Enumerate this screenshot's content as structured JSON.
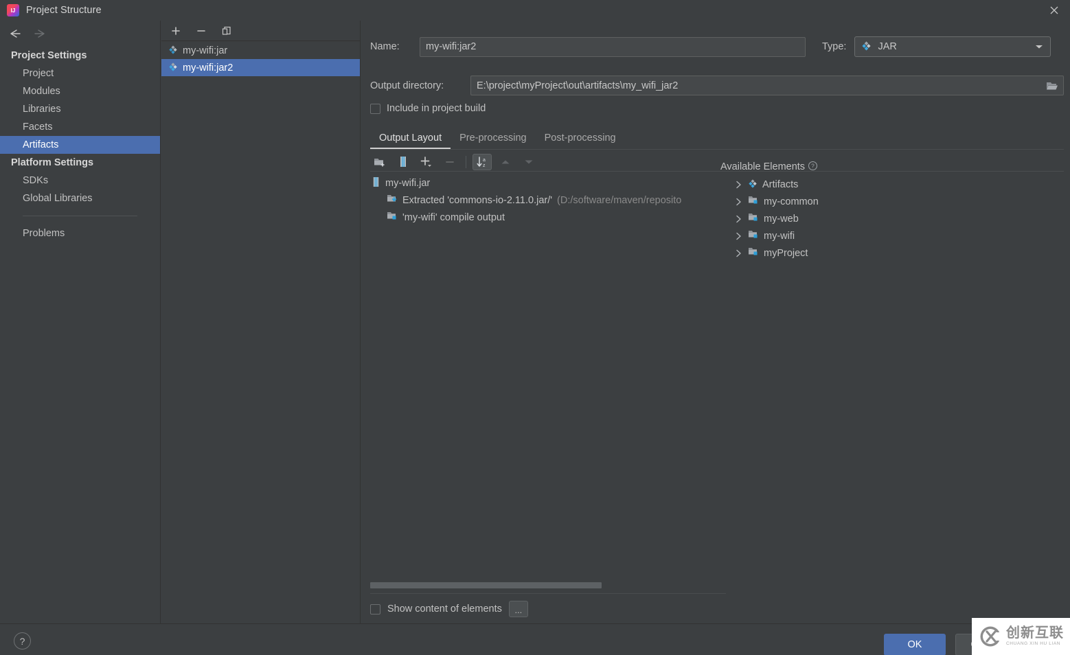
{
  "window": {
    "title": "Project Structure",
    "app_icon": "intellij-idea-icon",
    "close_icon": "close-icon"
  },
  "sidebar": {
    "back_icon": "arrow-left-icon",
    "forward_icon": "arrow-right-icon",
    "groups": [
      {
        "label": "Project Settings",
        "items": [
          {
            "label": "Project",
            "selected": false
          },
          {
            "label": "Modules",
            "selected": false
          },
          {
            "label": "Libraries",
            "selected": false
          },
          {
            "label": "Facets",
            "selected": false
          },
          {
            "label": "Artifacts",
            "selected": true
          }
        ]
      },
      {
        "label": "Platform Settings",
        "items": [
          {
            "label": "SDKs",
            "selected": false
          },
          {
            "label": "Global Libraries",
            "selected": false
          }
        ]
      }
    ],
    "problems": {
      "label": "Problems"
    }
  },
  "artifact_panel": {
    "toolbar": [
      {
        "name": "add-artifact-button",
        "icon": "plus-icon"
      },
      {
        "name": "remove-artifact-button",
        "icon": "minus-icon"
      },
      {
        "name": "copy-artifact-button",
        "icon": "copy-icon"
      }
    ],
    "items": [
      {
        "label": "my-wifi:jar",
        "icon": "artifact-icon",
        "selected": false
      },
      {
        "label": "my-wifi:jar2",
        "icon": "artifact-icon",
        "selected": true
      }
    ]
  },
  "details": {
    "name_label": "Name:",
    "name_value": "my-wifi:jar2",
    "type_label": "Type:",
    "type_value": "JAR",
    "type_icon": "artifact-icon",
    "type_caret": "chevron-down-icon",
    "output_label": "Output directory:",
    "output_value": "E:\\project\\myProject\\out\\artifacts\\my_wifi_jar2",
    "browse_icon": "folder-open-icon",
    "include_label": "Include in project build",
    "include_checked": false
  },
  "tabs": [
    {
      "label": "Output Layout",
      "active": true
    },
    {
      "label": "Pre-processing",
      "active": false
    },
    {
      "label": "Post-processing",
      "active": false
    }
  ],
  "layout_toolbar": [
    {
      "name": "create-directory-button",
      "icon": "new-folder-icon",
      "state": "normal"
    },
    {
      "name": "create-archive-button",
      "icon": "archive-icon",
      "state": "normal"
    },
    {
      "name": "add-copy-of-button",
      "icon": "plus-dropdown-icon",
      "state": "normal"
    },
    {
      "name": "remove-element-button",
      "icon": "minus-icon",
      "state": "disabled"
    },
    {
      "name": "sort-elements-button",
      "icon": "sort-az-icon",
      "state": "active"
    },
    {
      "name": "move-up-button",
      "icon": "arrow-up-icon",
      "state": "disabled"
    },
    {
      "name": "move-down-button",
      "icon": "arrow-down-icon",
      "state": "disabled"
    }
  ],
  "output_tree": [
    {
      "label": "my-wifi.jar",
      "suffix": "",
      "icon": "archive-icon",
      "depth": 1
    },
    {
      "label": "Extracted 'commons-io-2.11.0.jar/'",
      "suffix": "(D:/software/maven/reposito",
      "icon": "extracted-icon",
      "depth": 2
    },
    {
      "label": "'my-wifi' compile output",
      "suffix": "",
      "icon": "compile-output-icon",
      "depth": 2
    }
  ],
  "available": {
    "header": "Available Elements",
    "help_icon": "help-circle-icon",
    "items": [
      {
        "label": "Artifacts",
        "icon": "artifact-icon",
        "chevron": "chevron-right-icon"
      },
      {
        "label": "my-common",
        "icon": "module-icon",
        "chevron": "chevron-right-icon"
      },
      {
        "label": "my-web",
        "icon": "module-icon",
        "chevron": "chevron-right-icon"
      },
      {
        "label": "my-wifi",
        "icon": "module-icon",
        "chevron": "chevron-right-icon"
      },
      {
        "label": "myProject",
        "icon": "module-icon",
        "chevron": "chevron-right-icon"
      }
    ]
  },
  "footer": {
    "show_content_label": "Show content of elements",
    "show_content_checked": false,
    "dots_label": "...",
    "help_label": "?",
    "ok_label": "OK",
    "cancel_label": "Cancel"
  },
  "watermark": {
    "cn": "创新互联",
    "en": "CHUANG XIN HU LIAN",
    "logo_icon": "cx-logo-icon"
  },
  "colors": {
    "background": "#3c3f41",
    "selection": "#4b6eaf",
    "accent_blue": "#3592c4",
    "text": "#c2c2c2",
    "muted_text": "#8a8a8a"
  }
}
